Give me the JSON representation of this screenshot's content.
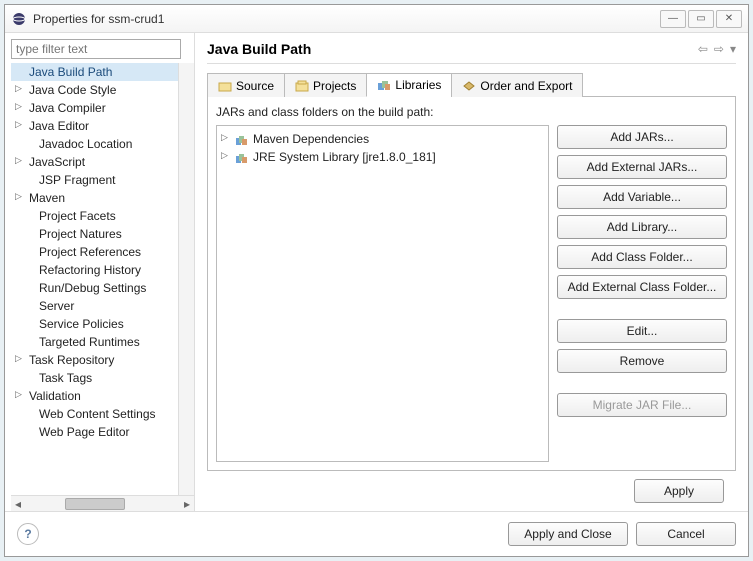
{
  "window": {
    "title": "Properties for ssm-crud1"
  },
  "filter": {
    "placeholder": "type filter text"
  },
  "tree": [
    {
      "label": "Java Build Path",
      "expandable": false,
      "selected": true
    },
    {
      "label": "Java Code Style",
      "expandable": true
    },
    {
      "label": "Java Compiler",
      "expandable": true
    },
    {
      "label": "Java Editor",
      "expandable": true
    },
    {
      "label": "Javadoc Location",
      "expandable": false,
      "child": true
    },
    {
      "label": "JavaScript",
      "expandable": true
    },
    {
      "label": "JSP Fragment",
      "expandable": false,
      "child": true
    },
    {
      "label": "Maven",
      "expandable": true
    },
    {
      "label": "Project Facets",
      "expandable": false,
      "child": true
    },
    {
      "label": "Project Natures",
      "expandable": false,
      "child": true
    },
    {
      "label": "Project References",
      "expandable": false,
      "child": true
    },
    {
      "label": "Refactoring History",
      "expandable": false,
      "child": true
    },
    {
      "label": "Run/Debug Settings",
      "expandable": false,
      "child": true
    },
    {
      "label": "Server",
      "expandable": false,
      "child": true
    },
    {
      "label": "Service Policies",
      "expandable": false,
      "child": true
    },
    {
      "label": "Targeted Runtimes",
      "expandable": false,
      "child": true
    },
    {
      "label": "Task Repository",
      "expandable": true
    },
    {
      "label": "Task Tags",
      "expandable": false,
      "child": true
    },
    {
      "label": "Validation",
      "expandable": true
    },
    {
      "label": "Web Content Settings",
      "expandable": false,
      "child": true
    },
    {
      "label": "Web Page Editor",
      "expandable": false,
      "child": true
    }
  ],
  "page": {
    "heading": "Java Build Path",
    "tabs": [
      {
        "label": "Source"
      },
      {
        "label": "Projects"
      },
      {
        "label": "Libraries",
        "active": true
      },
      {
        "label": "Order and Export"
      }
    ],
    "panel_label": "JARs and class folders on the build path:",
    "jars": [
      {
        "label": "Maven Dependencies"
      },
      {
        "label": "JRE System Library [jre1.8.0_181]"
      }
    ],
    "buttons": {
      "add_jars": "Add JARs...",
      "add_external_jars": "Add External JARs...",
      "add_variable": "Add Variable...",
      "add_library": "Add Library...",
      "add_class_folder": "Add Class Folder...",
      "add_external_class_folder": "Add External Class Folder...",
      "edit": "Edit...",
      "remove": "Remove",
      "migrate": "Migrate JAR File..."
    },
    "apply": "Apply"
  },
  "footer": {
    "apply_close": "Apply and Close",
    "cancel": "Cancel"
  }
}
